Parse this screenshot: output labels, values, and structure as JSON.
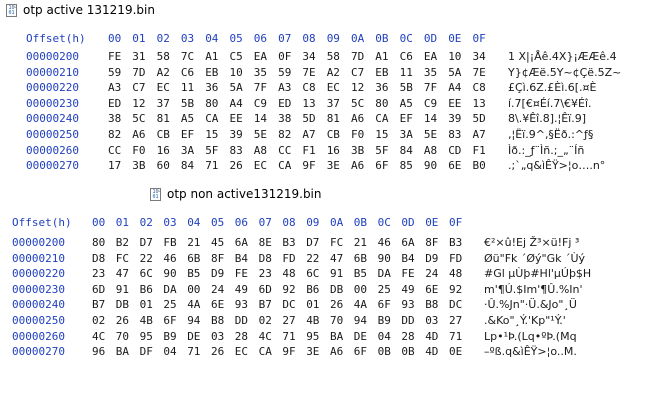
{
  "window_top": {
    "title": "otp active 131219.bin",
    "header": {
      "offset_label": "Offset(h)",
      "columns": [
        "00",
        "01",
        "02",
        "03",
        "04",
        "05",
        "06",
        "07",
        "08",
        "09",
        "0A",
        "0B",
        "0C",
        "0D",
        "0E",
        "0F"
      ]
    },
    "rows": [
      {
        "offset": "00000200",
        "bytes": [
          "FE",
          "31",
          "58",
          "7C",
          "A1",
          "C5",
          "EA",
          "0F",
          "34",
          "58",
          "7D",
          "A1",
          "C6",
          "EA",
          "10",
          "34"
        ],
        "ascii": "1 X|¡Åê.4X}¡ÆÆê.4"
      },
      {
        "offset": "00000210",
        "bytes": [
          "59",
          "7D",
          "A2",
          "C6",
          "EB",
          "10",
          "35",
          "59",
          "7E",
          "A2",
          "C7",
          "EB",
          "11",
          "35",
          "5A",
          "7E"
        ],
        "ascii": "Y}¢Æë.5Y~¢Çë.5Z~"
      },
      {
        "offset": "00000220",
        "bytes": [
          "A3",
          "C7",
          "EC",
          "11",
          "36",
          "5A",
          "7F",
          "A3",
          "C8",
          "EC",
          "12",
          "36",
          "5B",
          "7F",
          "A4",
          "C8"
        ],
        "ascii": "£Çì.6Z.£Èì.6[.¤È"
      },
      {
        "offset": "00000230",
        "bytes": [
          "ED",
          "12",
          "37",
          "5B",
          "80",
          "A4",
          "C9",
          "ED",
          "13",
          "37",
          "5C",
          "80",
          "A5",
          "C9",
          "EE",
          "13"
        ],
        "ascii": "í.7[€¤Éí.7\\€¥Éî."
      },
      {
        "offset": "00000240",
        "bytes": [
          "38",
          "5C",
          "81",
          "A5",
          "CA",
          "EE",
          "14",
          "38",
          "5D",
          "81",
          "A6",
          "CA",
          "EF",
          "14",
          "39",
          "5D"
        ],
        "ascii": "8\\.¥Êî.8].¦Êï.9]"
      },
      {
        "offset": "00000250",
        "bytes": [
          "82",
          "A6",
          "CB",
          "EF",
          "15",
          "39",
          "5E",
          "82",
          "A7",
          "CB",
          "F0",
          "15",
          "3A",
          "5E",
          "83",
          "A7"
        ],
        "ascii": "‚¦Ëï.9^‚§Ëð.:^ƒ§"
      },
      {
        "offset": "00000260",
        "bytes": [
          "CC",
          "F0",
          "16",
          "3A",
          "5F",
          "83",
          "A8",
          "CC",
          "F1",
          "16",
          "3B",
          "5F",
          "84",
          "A8",
          "CD",
          "F1"
        ],
        "ascii": "Ìð.:_ƒ¨Ìñ.;_„¨Íñ"
      },
      {
        "offset": "00000270",
        "bytes": [
          "17",
          "3B",
          "60",
          "84",
          "71",
          "26",
          "EC",
          "CA",
          "9F",
          "3E",
          "A6",
          "6F",
          "85",
          "90",
          "6E",
          "B0"
        ],
        "ascii": ".;`„q&ìÊŸ>¦o….n°"
      }
    ]
  },
  "window_bottom": {
    "title": "otp non active131219.bin",
    "header": {
      "offset_label": "Offset(h)",
      "columns": [
        "00",
        "01",
        "02",
        "03",
        "04",
        "05",
        "06",
        "07",
        "08",
        "09",
        "0A",
        "0B",
        "0C",
        "0D",
        "0E",
        "0F"
      ]
    },
    "rows": [
      {
        "offset": "00000200",
        "bytes": [
          "80",
          "B2",
          "D7",
          "FB",
          "21",
          "45",
          "6A",
          "8E",
          "B3",
          "D7",
          "FC",
          "21",
          "46",
          "6A",
          "8F",
          "B3"
        ],
        "ascii": "€²×û!Ej Ž³×ü!Fj ³"
      },
      {
        "offset": "00000210",
        "bytes": [
          "D8",
          "FC",
          "22",
          "46",
          "6B",
          "8F",
          "B4",
          "D8",
          "FD",
          "22",
          "47",
          "6B",
          "90",
          "B4",
          "D9",
          "FD"
        ],
        "ascii": "Øü\"Fk ´Øý\"Gk ´Ùý"
      },
      {
        "offset": "00000220",
        "bytes": [
          "23",
          "47",
          "6C",
          "90",
          "B5",
          "D9",
          "FE",
          "23",
          "48",
          "6C",
          "91",
          "B5",
          "DA",
          "FE",
          "24",
          "48"
        ],
        "ascii": "#Gl µÙþ#Hl'µÚþ$H"
      },
      {
        "offset": "00000230",
        "bytes": [
          "6D",
          "91",
          "B6",
          "DA",
          "00",
          "24",
          "49",
          "6D",
          "92",
          "B6",
          "DB",
          "00",
          "25",
          "49",
          "6E",
          "92"
        ],
        "ascii": "m'¶Ú.$Im'¶Û.%In'"
      },
      {
        "offset": "00000240",
        "bytes": [
          "B7",
          "DB",
          "01",
          "25",
          "4A",
          "6E",
          "93",
          "B7",
          "DC",
          "01",
          "26",
          "4A",
          "6F",
          "93",
          "B8",
          "DC"
        ],
        "ascii": "·Û.%Jn\"·Ü.&Jo\"¸Ü"
      },
      {
        "offset": "00000250",
        "bytes": [
          "02",
          "26",
          "4B",
          "6F",
          "94",
          "B8",
          "DD",
          "02",
          "27",
          "4B",
          "70",
          "94",
          "B9",
          "DD",
          "03",
          "27"
        ],
        "ascii": ".&Ko\"¸Ý.'Kp\"¹Ý.'"
      },
      {
        "offset": "00000260",
        "bytes": [
          "4C",
          "70",
          "95",
          "B9",
          "DE",
          "03",
          "28",
          "4C",
          "71",
          "95",
          "BA",
          "DE",
          "04",
          "28",
          "4D",
          "71"
        ],
        "ascii": "Lp•¹Þ.(Lq•ºÞ.(Mq"
      },
      {
        "offset": "00000270",
        "bytes": [
          "96",
          "BA",
          "DF",
          "04",
          "71",
          "26",
          "EC",
          "CA",
          "9F",
          "3E",
          "A6",
          "6F",
          "0B",
          "0B",
          "4D",
          "0E"
        ],
        "ascii": "–ºß.q&ìÊŸ>¦o..M."
      }
    ]
  }
}
